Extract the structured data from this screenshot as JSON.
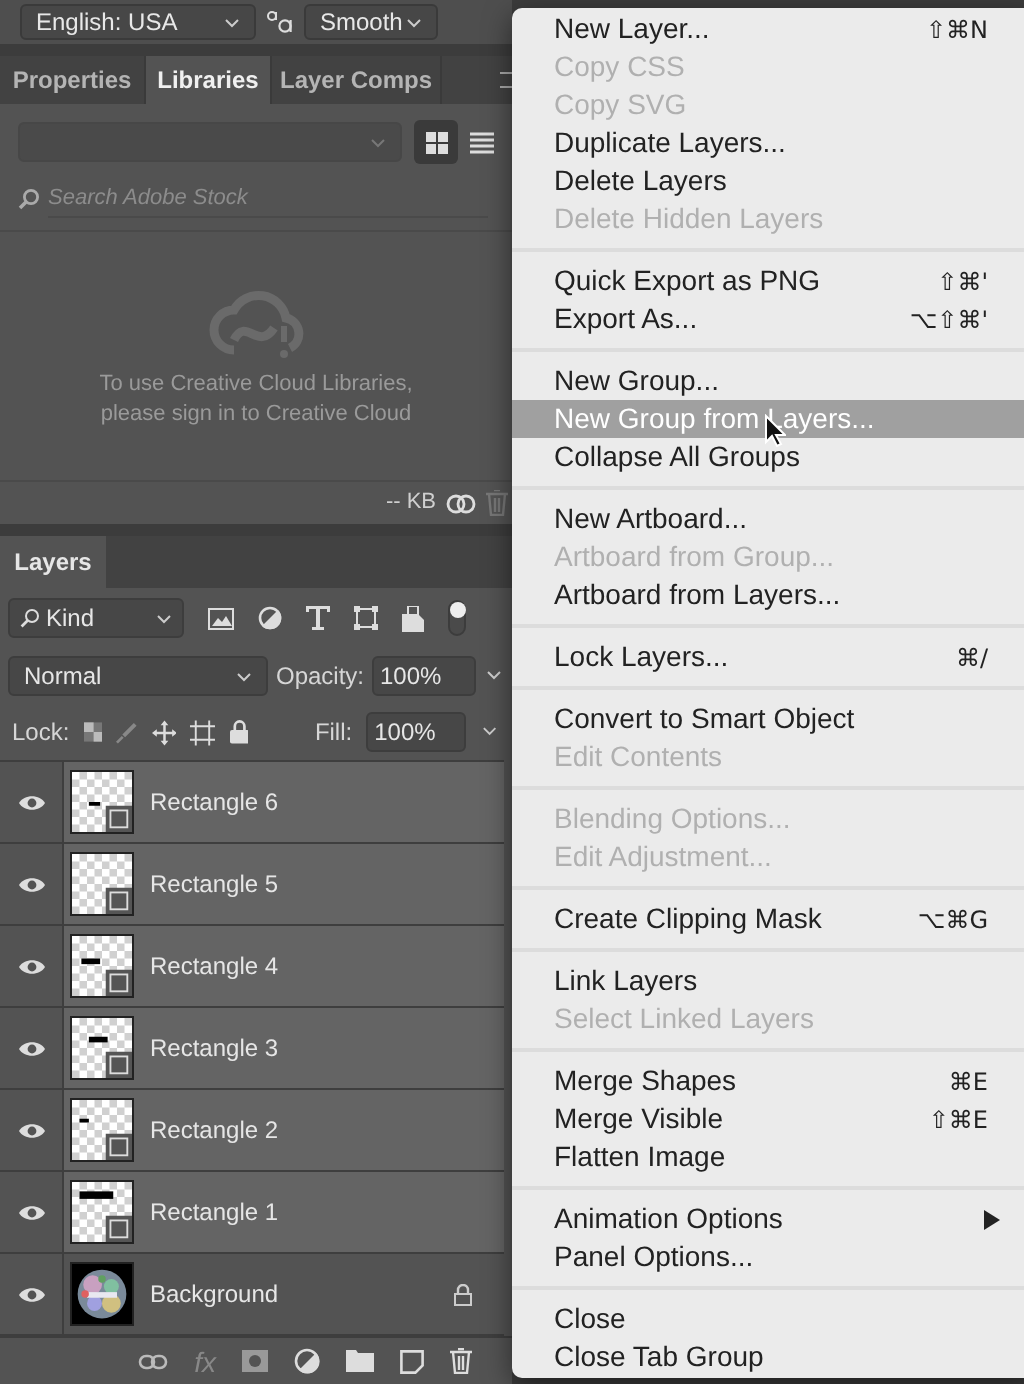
{
  "options_bar": {
    "language": "English: USA",
    "anti_aliasing": "Smooth"
  },
  "panel_tabs": [
    {
      "label": "Properties",
      "selected": false
    },
    {
      "label": "Libraries",
      "selected": true
    },
    {
      "label": "Layer Comps",
      "selected": false
    }
  ],
  "libraries": {
    "search_placeholder": "Search Adobe Stock",
    "message": "To use Creative Cloud Libraries, please sign in to Creative Cloud",
    "size": "-- KB"
  },
  "layers_panel": {
    "tab": "Layers",
    "filter": "Kind",
    "blend_mode": "Normal",
    "opacity_label": "Opacity:",
    "opacity": "100%",
    "lock_label": "Lock:",
    "fill_label": "Fill:",
    "fill": "100%",
    "effects_label": "fx",
    "layers": [
      {
        "name": "Rectangle 6",
        "kind": "shape",
        "selected": true,
        "visible": true,
        "locked": false
      },
      {
        "name": "Rectangle 5",
        "kind": "shape",
        "selected": true,
        "visible": true,
        "locked": false
      },
      {
        "name": "Rectangle 4",
        "kind": "shape",
        "selected": true,
        "visible": true,
        "locked": false
      },
      {
        "name": "Rectangle 3",
        "kind": "shape",
        "selected": true,
        "visible": true,
        "locked": false
      },
      {
        "name": "Rectangle 2",
        "kind": "shape",
        "selected": true,
        "visible": true,
        "locked": false
      },
      {
        "name": "Rectangle 1",
        "kind": "shape",
        "selected": true,
        "visible": true,
        "locked": false
      },
      {
        "name": "Background",
        "kind": "picture",
        "selected": false,
        "visible": true,
        "locked": true
      }
    ]
  },
  "context_menu": {
    "sections": [
      [
        {
          "label": "New Layer...",
          "shortcut": "⇧⌘N",
          "disabled": false,
          "selected": false
        },
        {
          "label": "Copy CSS",
          "disabled": true,
          "selected": false
        },
        {
          "label": "Copy SVG",
          "disabled": true,
          "selected": false
        },
        {
          "label": "Duplicate Layers...",
          "disabled": false,
          "selected": false
        },
        {
          "label": "Delete Layers",
          "disabled": false,
          "selected": false
        },
        {
          "label": "Delete Hidden Layers",
          "disabled": true,
          "selected": false
        }
      ],
      [
        {
          "label": "Quick Export as PNG",
          "shortcut": "⇧⌘'",
          "disabled": false,
          "selected": false
        },
        {
          "label": "Export As...",
          "shortcut": "⌥⇧⌘'",
          "disabled": false,
          "selected": false
        }
      ],
      [
        {
          "label": "New Group...",
          "disabled": false,
          "selected": false
        },
        {
          "label": "New Group from Layers...",
          "disabled": false,
          "selected": true
        },
        {
          "label": "Collapse All Groups",
          "disabled": false,
          "selected": false
        }
      ],
      [
        {
          "label": "New Artboard...",
          "disabled": false,
          "selected": false
        },
        {
          "label": "Artboard from Group...",
          "disabled": true,
          "selected": false
        },
        {
          "label": "Artboard from Layers...",
          "disabled": false,
          "selected": false
        }
      ],
      [
        {
          "label": "Lock Layers...",
          "shortcut": "⌘/",
          "disabled": false,
          "selected": false
        }
      ],
      [
        {
          "label": "Convert to Smart Object",
          "disabled": false,
          "selected": false
        },
        {
          "label": "Edit Contents",
          "disabled": true,
          "selected": false
        }
      ],
      [
        {
          "label": "Blending Options...",
          "disabled": true,
          "selected": false
        },
        {
          "label": "Edit Adjustment...",
          "disabled": true,
          "selected": false
        }
      ],
      [
        {
          "label": "Create Clipping Mask",
          "shortcut": "⌥⌘G",
          "disabled": false,
          "selected": false
        }
      ],
      [
        {
          "label": "Link Layers",
          "disabled": false,
          "selected": false
        },
        {
          "label": "Select Linked Layers",
          "disabled": true,
          "selected": false
        }
      ],
      [
        {
          "label": "Merge Shapes",
          "shortcut": "⌘E",
          "disabled": false,
          "selected": false
        },
        {
          "label": "Merge Visible",
          "shortcut": "⇧⌘E",
          "disabled": false,
          "selected": false
        },
        {
          "label": "Flatten Image",
          "disabled": false,
          "selected": false
        }
      ],
      [
        {
          "label": "Animation Options",
          "submenu": true,
          "disabled": false,
          "selected": false
        },
        {
          "label": "Panel Options...",
          "disabled": false,
          "selected": false
        }
      ],
      [
        {
          "label": "Close",
          "disabled": false,
          "selected": false
        },
        {
          "label": "Close Tab Group",
          "disabled": false,
          "selected": false
        }
      ]
    ]
  }
}
